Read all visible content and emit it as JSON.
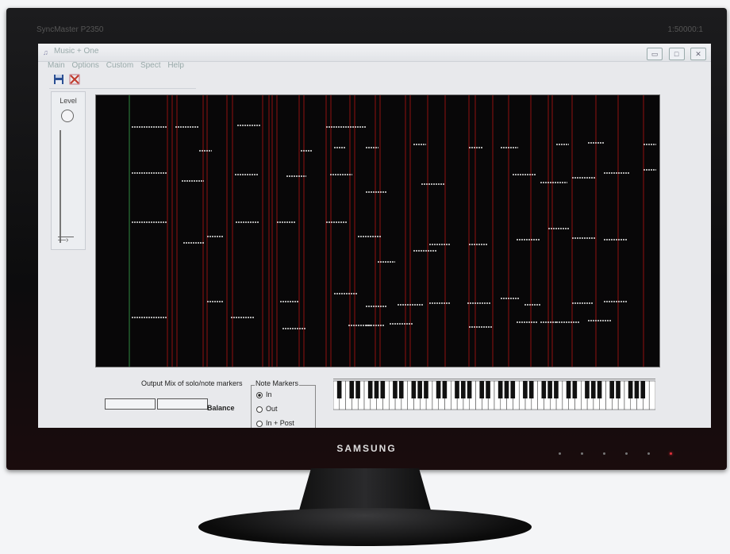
{
  "monitor": {
    "model": "SyncMaster P2350",
    "resolution": "1:50000:1",
    "brand": "SAMSUNG"
  },
  "window": {
    "title": "Music + One",
    "minimize": "▭",
    "maximize": "□",
    "close": "✕"
  },
  "menu": [
    "Main",
    "Options",
    "Custom",
    "Spect",
    "Help"
  ],
  "toolbar": {
    "save_icon": "save-icon",
    "close_icon": "close-icon"
  },
  "level": {
    "label": "Level",
    "value": 0.0
  },
  "mix": {
    "label": "Output Mix of solo/note markers",
    "balance_label": "Balance"
  },
  "note_markers": {
    "label": "Note Markers",
    "options": [
      "In",
      "Out",
      "In + Post"
    ],
    "selected": "In"
  },
  "colors": {
    "spectrogram_bg": "#080708",
    "marker_line": "#7a1010",
    "notes": "#e6e6e6",
    "accent": "#2e8a40"
  }
}
